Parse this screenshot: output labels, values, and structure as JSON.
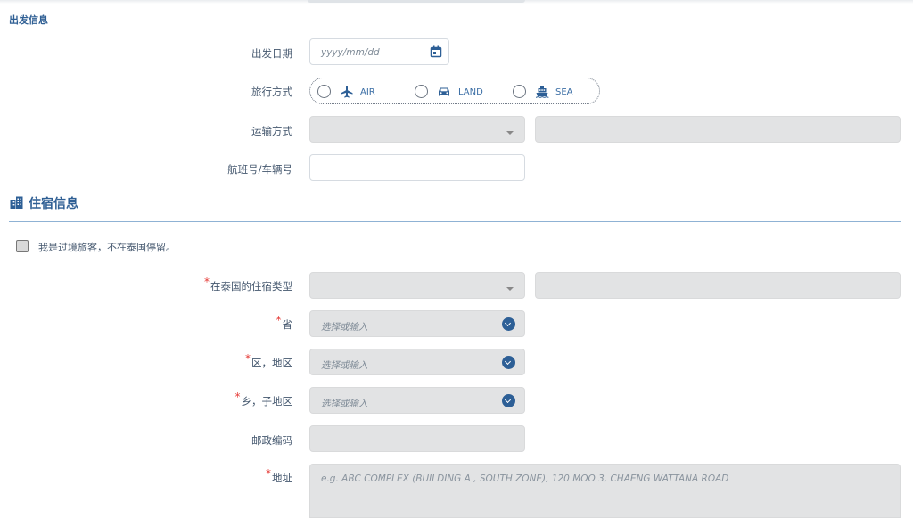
{
  "departure": {
    "section_title": "出发信息",
    "date_label": "出发日期",
    "date_placeholder": "yyyy/mm/dd",
    "travel_mode_label": "旅行方式",
    "modes": [
      {
        "label": "AIR",
        "icon": "airplane-icon"
      },
      {
        "label": "LAND",
        "icon": "car-icon"
      },
      {
        "label": "SEA",
        "icon": "ship-icon"
      }
    ],
    "transport_label": "运输方式",
    "flight_label": "航班号/车辆号"
  },
  "accommodation": {
    "section_title": "住宿信息",
    "section_icon": "building-icon",
    "transit_checkbox_label": "我是过境旅客，不在泰国停留。",
    "type_label": "在泰国的住宿类型",
    "province_label": "省",
    "province_placeholder": "选择或输入",
    "district_label": "区，地区",
    "district_placeholder": "选择或输入",
    "subdistrict_label": "乡，子地区",
    "subdistrict_placeholder": "选择或输入",
    "postal_label": "邮政编码",
    "address_label": "地址",
    "address_placeholder": "e.g. ABC COMPLEX (BUILDING A , SOUTH ZONE), 120 MOO 3, CHAENG WATTANA ROAD",
    "required_mark": "*"
  },
  "colors": {
    "accent": "#2f5f94",
    "required": "#e53935",
    "disabled_field": "#e2e3e4"
  }
}
